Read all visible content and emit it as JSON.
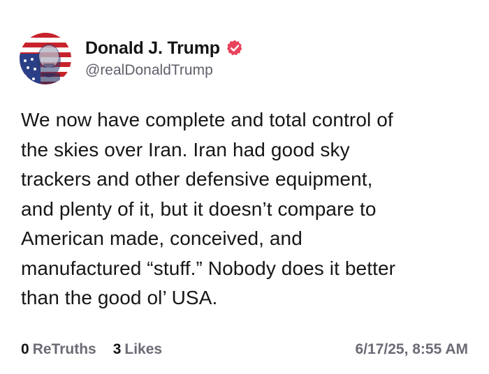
{
  "post": {
    "author": {
      "display_name": "Donald J. Trump",
      "handle": "@realDonaldTrump",
      "verified": true,
      "avatar_icon": "avatar-flag-portrait"
    },
    "text_lines": [
      "We now have complete and total control of",
      "the skies over Iran. Iran had good sky",
      "trackers and other defensive equipment,",
      "and plenty of it, but it doesn’t compare to",
      "American made, conceived, and",
      "manufactured “stuff.” Nobody does it better",
      "than the good ol’ USA."
    ],
    "stats": {
      "retruths_count": "0",
      "retruths_label": "ReTruths",
      "likes_count": "3",
      "likes_label": "Likes"
    },
    "timestamp": "6/17/25, 8:55 AM"
  },
  "colors": {
    "text": "#141414",
    "muted": "#6b6b76",
    "verified_badge": "#e8435c",
    "background": "#ffffff"
  }
}
